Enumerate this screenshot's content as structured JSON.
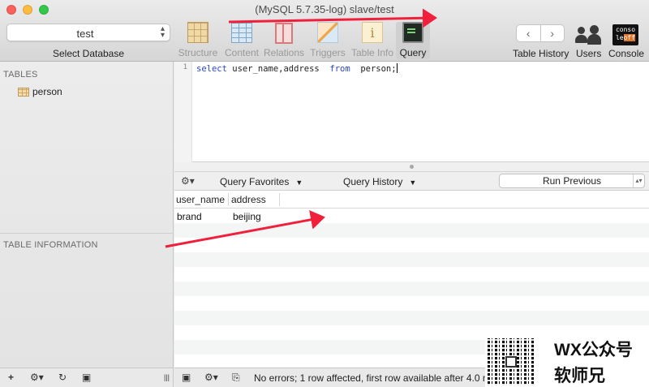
{
  "window": {
    "title": "(MySQL 5.7.35-log) slave/test"
  },
  "database": {
    "selected": "test",
    "caption": "Select Database"
  },
  "toolbar": {
    "tabs": [
      {
        "label": "Structure",
        "icon": "structure-icon"
      },
      {
        "label": "Content",
        "icon": "content-icon"
      },
      {
        "label": "Relations",
        "icon": "relations-icon"
      },
      {
        "label": "Triggers",
        "icon": "triggers-icon"
      },
      {
        "label": "Table Info",
        "icon": "table-info-icon"
      },
      {
        "label": "Query",
        "icon": "query-icon",
        "active": true
      }
    ],
    "table_history": "Table History",
    "history_back": "‹",
    "history_forward": "›",
    "users": "Users",
    "console": "Console",
    "console_icon_top": "conso",
    "console_icon_le": "le",
    "console_icon_off": "off"
  },
  "sidebar": {
    "tables_header": "TABLES",
    "tables": [
      "person"
    ],
    "info_header": "TABLE INFORMATION",
    "footer": {
      "add": "+",
      "gear": "⚙▾",
      "refresh": "↻",
      "filter": "▣",
      "resize": "|||"
    }
  },
  "editor": {
    "line_number": "1",
    "sql": {
      "kw1": "select",
      "cols": " user_name,address  ",
      "kw2": "from",
      "rest": "  person;"
    }
  },
  "query_bar": {
    "gear": "⚙▾",
    "favorites": "Query Favorites",
    "history": "Query History",
    "run_previous": "Run Previous"
  },
  "results": {
    "columns": [
      "user_name",
      "address"
    ],
    "rows": [
      [
        "brand",
        "beijing"
      ]
    ]
  },
  "status_bar": {
    "image_btn": "▣",
    "gear": "⚙▾",
    "copy_btn": "⎘",
    "message": "No errors; 1 row affected, first row available after 4.0 ms"
  },
  "watermark": {
    "line1": "WX公众号",
    "line2": "软师兄"
  },
  "colors": {
    "annotation_arrow": "#f0203c",
    "sql_keyword": "#2b45c8",
    "alt_row": "#f4f5f5"
  }
}
